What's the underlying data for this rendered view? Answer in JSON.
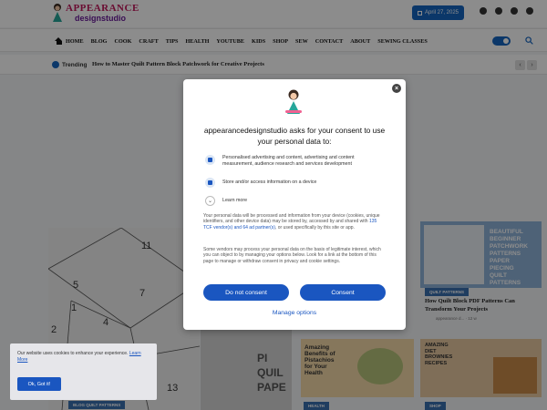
{
  "site": {
    "brand_line1": "APPEARANCE",
    "brand_line2": "designstudio",
    "date": "April 27, 2025",
    "socials": [
      "facebook-icon",
      "youtube-icon",
      "pinterest-icon",
      "instagram-icon"
    ]
  },
  "nav": {
    "items": [
      "HOME",
      "BLOG",
      "COOK",
      "CRAFT",
      "TIPS",
      "HEALTH",
      "YOUTUBE",
      "KIDS",
      "SHOP",
      "SEW",
      "CONTACT",
      "ABOUT",
      "SEWING CLASSES"
    ]
  },
  "trending": {
    "label": "Trending",
    "headline": "How to Master Quilt Pattern Block Patchwork for Creative Projects"
  },
  "pattern": {
    "numbers": [
      "11",
      "5",
      "7",
      "4",
      "1",
      "2",
      "13"
    ]
  },
  "button_img": {
    "words": [
      "PI",
      "QUIL",
      "PAPE"
    ]
  },
  "cards": {
    "right_card_text": [
      "BEAUTIFUL",
      "BEGINNER",
      "PATCHWORK",
      "PATTERNS",
      "PAPER",
      "PIECING",
      "QUILT",
      "PATTERNS"
    ],
    "right_tag": "QUILT PATTERNS",
    "right_title": "How Quilt Block PDF Patterns Can Transform Your Projects",
    "right_meta": "appearance d... · 12 w",
    "pist_text": [
      "Amazing",
      "Benefits of",
      "Pistachios",
      "for Your",
      "Health"
    ],
    "pist_tag": "HEALTH",
    "diet_text": [
      "AMAZING",
      "DIET",
      "BROWNIES",
      "RECIPES"
    ],
    "diet_tag": "SHOP",
    "left_tag": "BLOG QUILT PATTERNS"
  },
  "consent": {
    "title": "appearancedesignstudio asks for your consent to use your personal data to:",
    "purposes": [
      "Personalised advertising and content, advertising and content measurement, audience research and services development",
      "Store and/or access information on a device"
    ],
    "learn_more": "Learn more",
    "para1_a": "Your personal data will be processed and information from your device (cookies, unique identifiers, and other device data) may be stored by, accessed by and shared with ",
    "para1_link": "135 TCF vendor(s) and 64 ad partner(s)",
    "para1_b": ", or used specifically by this site or app.",
    "para2": "Some vendors may process your personal data on the basis of legitimate interest, which you can object to by managing your options below. Look for a link at the bottom of this page to manage or withdraw consent in privacy and cookie settings.",
    "do_not_consent": "Do not consent",
    "consent": "Consent",
    "manage_options": "Manage options"
  },
  "cookie": {
    "text": "Our website uses cookies to enhance your experience.",
    "link": "Learn More",
    "ok": "Ok, Got it!"
  },
  "colors": {
    "accent": "#1a56c0",
    "brand_pink": "#c2185b"
  }
}
